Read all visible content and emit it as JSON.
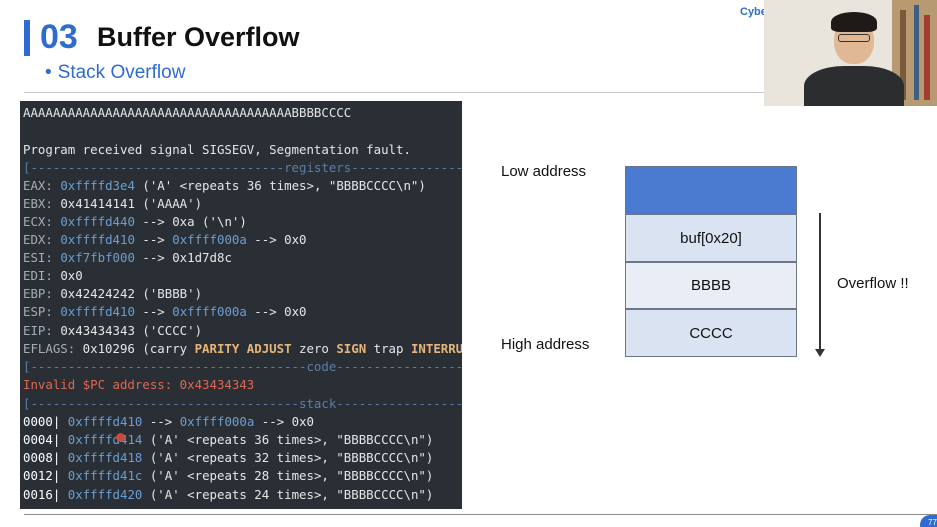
{
  "slide": {
    "section_number": "03",
    "title": "Buffer Overflow",
    "subtitle_bullet": "•",
    "subtitle": "Stack Overflow",
    "brand_text": "Cybe",
    "page_number": "77"
  },
  "terminal": {
    "line_input": "AAAAAAAAAAAAAAAAAAAAAAAAAAAAAAAAAAAABBBBCCCC",
    "line_signal": "Program received signal SIGSEGV, Segmentation fault.",
    "sep_registers": "[----------------------------------registers-----------------------------------]",
    "registers": [
      {
        "name": "EAX",
        "addr": "0xffffd3e4",
        "rest": " ('A' <repeats 36 times>, \"BBBBCCCC\\n\")"
      },
      {
        "name": "EBX",
        "addr": "0x41414141",
        "rest": " ('AAAA')"
      },
      {
        "name": "ECX",
        "addr": "0xffffd440",
        "rest": " --> 0xa ('\\n')"
      },
      {
        "name": "EDX",
        "addr": "0xffffd410",
        "rest": " --> ",
        "addr2": "0xffff000a",
        "rest2": " --> 0x0"
      },
      {
        "name": "ESI",
        "addr": "0xf7fbf000",
        "rest": " --> 0x1d7d8c"
      },
      {
        "name": "EDI",
        "addr": "",
        "rest": "0x0"
      },
      {
        "name": "EBP",
        "addr": "",
        "rest": "0x42424242 ('BBBB')"
      },
      {
        "name": "ESP",
        "addr": "0xffffd410",
        "rest": " --> ",
        "addr2": "0xffff000a",
        "rest2": " --> 0x0"
      },
      {
        "name": "EIP",
        "addr": "",
        "rest": "0x43434343 ('CCCC')"
      }
    ],
    "eflags_label": "EFLAGS:",
    "eflags_value": " 0x10296 (carry ",
    "eflags_flag1": "PARITY ADJUST",
    "eflags_mid": " zero ",
    "eflags_flag2": "SIGN",
    "eflags_mid2": " trap ",
    "eflags_flag3": "INTERRUPT",
    "sep_code": "[-------------------------------------code-------------------------------------]",
    "invalid_pc": "Invalid $PC address: 0x43434343",
    "sep_stack": "[------------------------------------stack-------------------------------------]",
    "stack_rows": [
      {
        "offset": "0000|",
        "addr": "0xffffd410",
        "rest": " --> ",
        "addr2": "0xffff000a",
        "rest2": " --> 0x0"
      },
      {
        "offset": "0004|",
        "addr": "0xffffd414",
        "rest": " ('A' <repeats 36 times>, \"BBBBCCCC\\n\")"
      },
      {
        "offset": "0008|",
        "addr": "0xffffd418",
        "rest": " ('A' <repeats 32 times>, \"BBBBCCCC\\n\")"
      },
      {
        "offset": "0012|",
        "addr": "0xffffd41c",
        "rest": " ('A' <repeats 28 times>, \"BBBBCCCC\\n\")"
      },
      {
        "offset": "0016|",
        "addr": "0xffffd420",
        "rest": " ('A' <repeats 24 times>, \"BBBBCCCC\\n\")"
      }
    ]
  },
  "diagram": {
    "low_address": "Low address",
    "high_address": "High address",
    "blocks": [
      "buf[0x20]",
      "BBBB",
      "CCCC"
    ],
    "overflow_label": "Overflow !!"
  },
  "colors": {
    "accent": "#2f6bd0",
    "terminal_bg": "#2a2f36",
    "error_text": "#e0674f",
    "block_top": "#4b7bd0"
  }
}
